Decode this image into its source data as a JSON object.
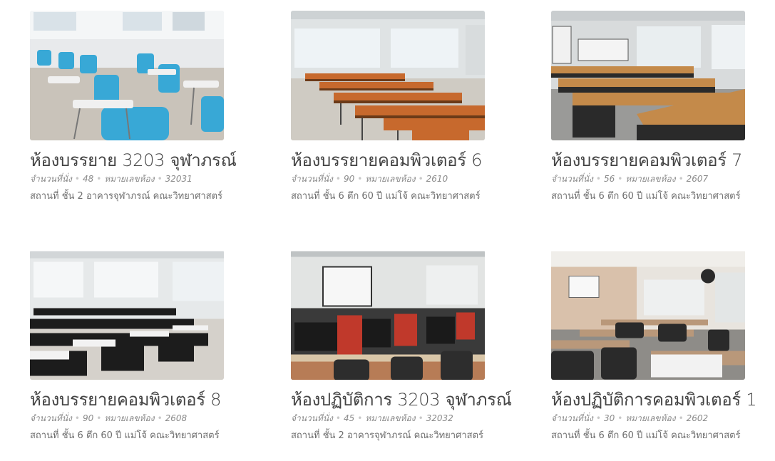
{
  "rooms": [
    {
      "title": "ห้องบรรยาย 3203 จุฬาภรณ์",
      "seats_label": "จำนวนที่นั่ง",
      "seats": "48",
      "room_no_label": "หมายเลขห้อง",
      "room_no": "32031",
      "location": "สถานที่ ชั้น 2 อาคารจุฬาภรณ์ คณะวิทยาศาสตร์",
      "image": "lecture-room-blue-chairs-photo"
    },
    {
      "title": "ห้องบรรยายคอมพิวเตอร์ 6",
      "seats_label": "จำนวนที่นั่ง",
      "seats": "90",
      "room_no_label": "หมายเลขห้อง",
      "room_no": "2610",
      "location": "สถานที่ ชั้น 6 ตึก 60 ปี แม่โจ้ คณะวิทยาศาสตร์",
      "image": "lecture-room-orange-chairs-photo"
    },
    {
      "title": "ห้องบรรยายคอมพิวเตอร์ 7",
      "seats_label": "จำนวนที่นั่ง",
      "seats": "56",
      "room_no_label": "หมายเลขห้อง",
      "room_no": "2607",
      "location": "สถานที่ ชั้น 6 ตึก 60 ปี แม่โจ้ คณะวิทยาศาสตร์",
      "image": "lecture-room-wooden-desks-photo"
    },
    {
      "title": "ห้องบรรยายคอมพิวเตอร์ 8",
      "seats_label": "จำนวนที่นั่ง",
      "seats": "90",
      "room_no_label": "หมายเลขห้อง",
      "room_no": "2608",
      "location": "สถานที่ ชั้น 6 ตึก 60 ปี แม่โจ้ คณะวิทยาศาสตร์",
      "image": "lecture-room-black-chairs-photo"
    },
    {
      "title": "ห้องปฏิบัติการ 3203 จุฬาภรณ์",
      "seats_label": "จำนวนที่นั่ง",
      "seats": "45",
      "room_no_label": "หมายเลขห้อง",
      "room_no": "32032",
      "location": "สถานที่ ชั้น 2 อาคารจุฬาภรณ์ คณะวิทยาศาสตร์",
      "image": "computer-lab-red-pcs-photo"
    },
    {
      "title": "ห้องปฏิบัติการคอมพิวเตอร์ 1",
      "seats_label": "จำนวนที่นั่ง",
      "seats": "30",
      "room_no_label": "หมายเลขห้อง",
      "room_no": "2602",
      "location": "สถานที่ ชั้น 6 ตึก 60 ปี แม่โจ้ คณะวิทยาศาสตร์",
      "image": "computer-lab-classroom-photo"
    }
  ]
}
